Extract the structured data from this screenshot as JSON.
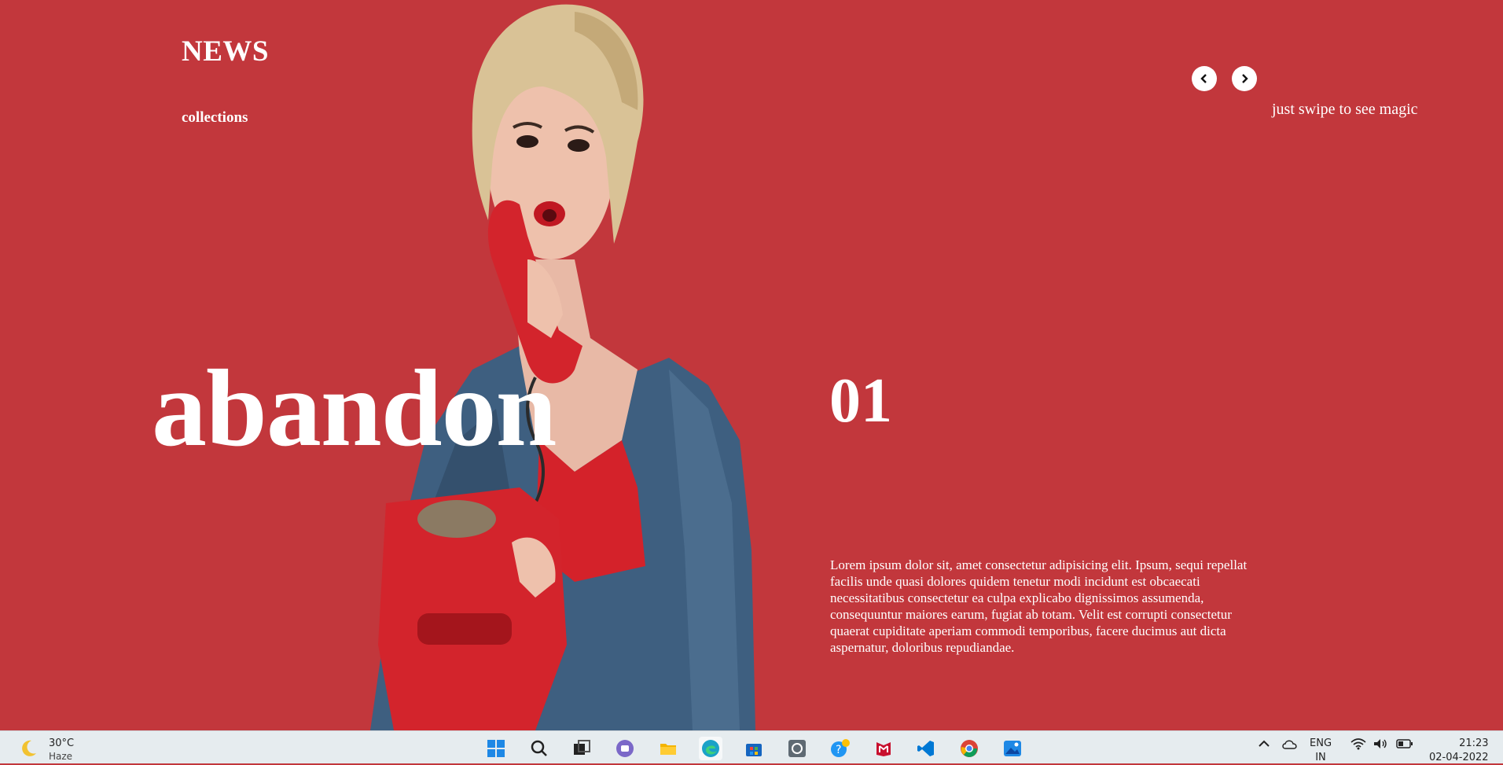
{
  "header": {
    "brand": "NEWS",
    "nav_link": "collections",
    "swipe_hint": "just swipe to see magic",
    "prev_icon": "chevron-left-icon",
    "next_icon": "chevron-right-icon"
  },
  "hero": {
    "title": "abandon",
    "slide_number": "01",
    "description": "Lorem ipsum dolor sit, amet consectetur adipisicing elit. Ipsum, sequi repellat facilis unde quasi dolores quidem tenetur modi incidunt est obcaecati necessitatibus consectetur ea culpa explicabo dignissimos assumenda, consequuntur maiores earum, fugiat ab totam. Velit est corrupti consectetur quaerat cupiditate aperiam commodi temporibus, facere ducimus aut dicta aspernatur, doloribus repudiandae."
  },
  "colors": {
    "background": "#c2373c",
    "text": "#ffffff",
    "taskbar": "#e6ecef"
  },
  "taskbar": {
    "weather_temp": "30°C",
    "weather_condition": "Haze",
    "apps": [
      "windows-start-icon",
      "search-icon",
      "task-view-icon",
      "teams-chat-icon",
      "file-explorer-icon",
      "edge-browser-icon",
      "microsoft-store-icon",
      "app-icon",
      "get-help-icon",
      "mcafee-icon",
      "vscode-icon",
      "chrome-icon",
      "photos-icon"
    ],
    "language_line1": "ENG",
    "language_line2": "IN",
    "time": "21:23",
    "date": "02-04-2022"
  }
}
